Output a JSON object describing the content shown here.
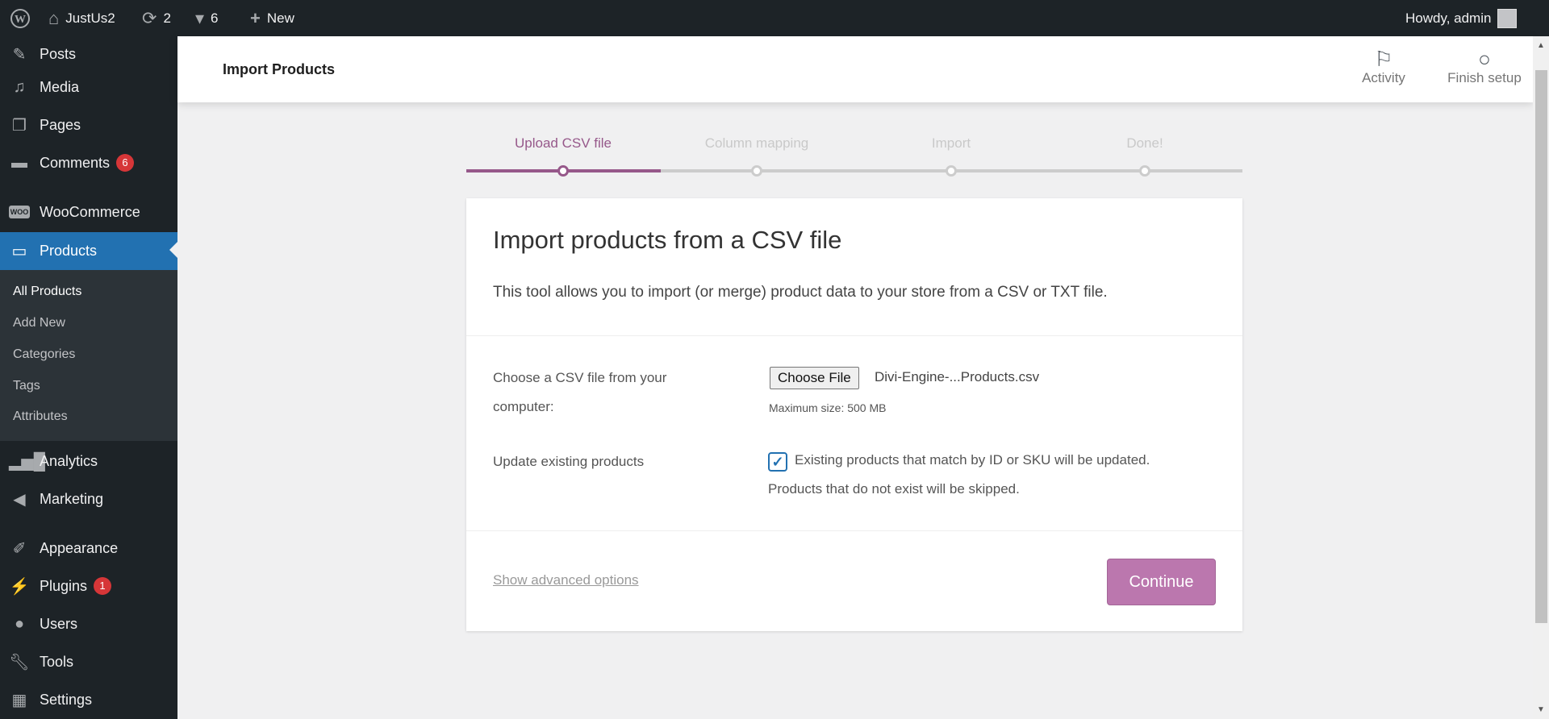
{
  "adminbar": {
    "site_name": "JustUs2",
    "updates_count": "2",
    "comments_count": "6",
    "new_label": "New",
    "greeting": "Howdy, admin"
  },
  "sidebar": {
    "items": [
      {
        "label": "Posts",
        "icon": "📌"
      },
      {
        "label": "Media",
        "icon": "🎞"
      },
      {
        "label": "Pages",
        "icon": "📄"
      },
      {
        "label": "Comments",
        "icon": "💬",
        "badge": "6"
      },
      {
        "label": "WooCommerce",
        "icon": "woo"
      },
      {
        "label": "Products",
        "icon": "▭"
      },
      {
        "label": "Analytics",
        "icon": "▮"
      },
      {
        "label": "Marketing",
        "icon": "📣"
      },
      {
        "label": "Appearance",
        "icon": "🖌"
      },
      {
        "label": "Plugins",
        "icon": "🔌",
        "badge": "1"
      },
      {
        "label": "Users",
        "icon": "👤"
      },
      {
        "label": "Tools",
        "icon": "🔧"
      },
      {
        "label": "Settings",
        "icon": "⚙"
      }
    ],
    "submenu": [
      "All Products",
      "Add New",
      "Categories",
      "Tags",
      "Attributes"
    ]
  },
  "header": {
    "title": "Import Products",
    "activity_label": "Activity",
    "finish_setup_label": "Finish setup"
  },
  "stepper": {
    "steps": [
      "Upload CSV file",
      "Column mapping",
      "Import",
      "Done!"
    ],
    "active_index": 0
  },
  "card": {
    "title": "Import products from a CSV file",
    "description": "This tool allows you to import (or merge) product data to your store from a CSV or TXT file.",
    "file_label_line1": "Choose a CSV file from your",
    "file_label_line2": "computer:",
    "choose_file_label": "Choose File",
    "file_name": "Divi-Engine-...Products.csv",
    "max_size": "Maximum size: 500 MB",
    "update_label": "Update existing products",
    "update_checked": true,
    "update_text_line1": "Existing products that match by ID or SKU will be updated.",
    "update_text_line2": "Products that do not exist will be skipped.",
    "advanced_link": "Show advanced options",
    "continue_label": "Continue"
  },
  "colors": {
    "accent": "#96588a",
    "button": "#bb77ae",
    "admin_blue": "#2271b1",
    "badge_red": "#d63638"
  }
}
